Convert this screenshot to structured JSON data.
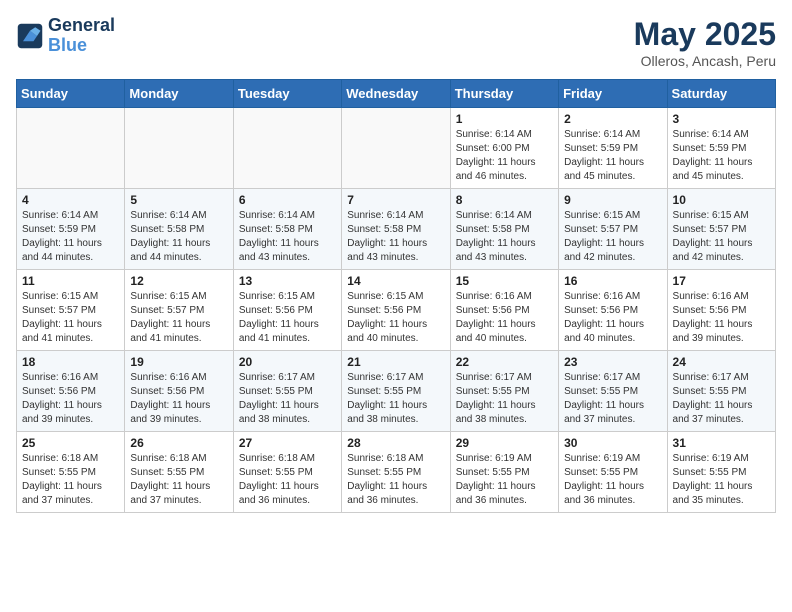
{
  "logo": {
    "line1": "General",
    "line2": "Blue"
  },
  "title": "May 2025",
  "subtitle": "Olleros, Ancash, Peru",
  "weekdays": [
    "Sunday",
    "Monday",
    "Tuesday",
    "Wednesday",
    "Thursday",
    "Friday",
    "Saturday"
  ],
  "weeks": [
    [
      {
        "day": "",
        "sunrise": "",
        "sunset": "",
        "daylight": ""
      },
      {
        "day": "",
        "sunrise": "",
        "sunset": "",
        "daylight": ""
      },
      {
        "day": "",
        "sunrise": "",
        "sunset": "",
        "daylight": ""
      },
      {
        "day": "",
        "sunrise": "",
        "sunset": "",
        "daylight": ""
      },
      {
        "day": "1",
        "sunrise": "Sunrise: 6:14 AM",
        "sunset": "Sunset: 6:00 PM",
        "daylight": "Daylight: 11 hours and 46 minutes."
      },
      {
        "day": "2",
        "sunrise": "Sunrise: 6:14 AM",
        "sunset": "Sunset: 5:59 PM",
        "daylight": "Daylight: 11 hours and 45 minutes."
      },
      {
        "day": "3",
        "sunrise": "Sunrise: 6:14 AM",
        "sunset": "Sunset: 5:59 PM",
        "daylight": "Daylight: 11 hours and 45 minutes."
      }
    ],
    [
      {
        "day": "4",
        "sunrise": "Sunrise: 6:14 AM",
        "sunset": "Sunset: 5:59 PM",
        "daylight": "Daylight: 11 hours and 44 minutes."
      },
      {
        "day": "5",
        "sunrise": "Sunrise: 6:14 AM",
        "sunset": "Sunset: 5:58 PM",
        "daylight": "Daylight: 11 hours and 44 minutes."
      },
      {
        "day": "6",
        "sunrise": "Sunrise: 6:14 AM",
        "sunset": "Sunset: 5:58 PM",
        "daylight": "Daylight: 11 hours and 43 minutes."
      },
      {
        "day": "7",
        "sunrise": "Sunrise: 6:14 AM",
        "sunset": "Sunset: 5:58 PM",
        "daylight": "Daylight: 11 hours and 43 minutes."
      },
      {
        "day": "8",
        "sunrise": "Sunrise: 6:14 AM",
        "sunset": "Sunset: 5:58 PM",
        "daylight": "Daylight: 11 hours and 43 minutes."
      },
      {
        "day": "9",
        "sunrise": "Sunrise: 6:15 AM",
        "sunset": "Sunset: 5:57 PM",
        "daylight": "Daylight: 11 hours and 42 minutes."
      },
      {
        "day": "10",
        "sunrise": "Sunrise: 6:15 AM",
        "sunset": "Sunset: 5:57 PM",
        "daylight": "Daylight: 11 hours and 42 minutes."
      }
    ],
    [
      {
        "day": "11",
        "sunrise": "Sunrise: 6:15 AM",
        "sunset": "Sunset: 5:57 PM",
        "daylight": "Daylight: 11 hours and 41 minutes."
      },
      {
        "day": "12",
        "sunrise": "Sunrise: 6:15 AM",
        "sunset": "Sunset: 5:57 PM",
        "daylight": "Daylight: 11 hours and 41 minutes."
      },
      {
        "day": "13",
        "sunrise": "Sunrise: 6:15 AM",
        "sunset": "Sunset: 5:56 PM",
        "daylight": "Daylight: 11 hours and 41 minutes."
      },
      {
        "day": "14",
        "sunrise": "Sunrise: 6:15 AM",
        "sunset": "Sunset: 5:56 PM",
        "daylight": "Daylight: 11 hours and 40 minutes."
      },
      {
        "day": "15",
        "sunrise": "Sunrise: 6:16 AM",
        "sunset": "Sunset: 5:56 PM",
        "daylight": "Daylight: 11 hours and 40 minutes."
      },
      {
        "day": "16",
        "sunrise": "Sunrise: 6:16 AM",
        "sunset": "Sunset: 5:56 PM",
        "daylight": "Daylight: 11 hours and 40 minutes."
      },
      {
        "day": "17",
        "sunrise": "Sunrise: 6:16 AM",
        "sunset": "Sunset: 5:56 PM",
        "daylight": "Daylight: 11 hours and 39 minutes."
      }
    ],
    [
      {
        "day": "18",
        "sunrise": "Sunrise: 6:16 AM",
        "sunset": "Sunset: 5:56 PM",
        "daylight": "Daylight: 11 hours and 39 minutes."
      },
      {
        "day": "19",
        "sunrise": "Sunrise: 6:16 AM",
        "sunset": "Sunset: 5:56 PM",
        "daylight": "Daylight: 11 hours and 39 minutes."
      },
      {
        "day": "20",
        "sunrise": "Sunrise: 6:17 AM",
        "sunset": "Sunset: 5:55 PM",
        "daylight": "Daylight: 11 hours and 38 minutes."
      },
      {
        "day": "21",
        "sunrise": "Sunrise: 6:17 AM",
        "sunset": "Sunset: 5:55 PM",
        "daylight": "Daylight: 11 hours and 38 minutes."
      },
      {
        "day": "22",
        "sunrise": "Sunrise: 6:17 AM",
        "sunset": "Sunset: 5:55 PM",
        "daylight": "Daylight: 11 hours and 38 minutes."
      },
      {
        "day": "23",
        "sunrise": "Sunrise: 6:17 AM",
        "sunset": "Sunset: 5:55 PM",
        "daylight": "Daylight: 11 hours and 37 minutes."
      },
      {
        "day": "24",
        "sunrise": "Sunrise: 6:17 AM",
        "sunset": "Sunset: 5:55 PM",
        "daylight": "Daylight: 11 hours and 37 minutes."
      }
    ],
    [
      {
        "day": "25",
        "sunrise": "Sunrise: 6:18 AM",
        "sunset": "Sunset: 5:55 PM",
        "daylight": "Daylight: 11 hours and 37 minutes."
      },
      {
        "day": "26",
        "sunrise": "Sunrise: 6:18 AM",
        "sunset": "Sunset: 5:55 PM",
        "daylight": "Daylight: 11 hours and 37 minutes."
      },
      {
        "day": "27",
        "sunrise": "Sunrise: 6:18 AM",
        "sunset": "Sunset: 5:55 PM",
        "daylight": "Daylight: 11 hours and 36 minutes."
      },
      {
        "day": "28",
        "sunrise": "Sunrise: 6:18 AM",
        "sunset": "Sunset: 5:55 PM",
        "daylight": "Daylight: 11 hours and 36 minutes."
      },
      {
        "day": "29",
        "sunrise": "Sunrise: 6:19 AM",
        "sunset": "Sunset: 5:55 PM",
        "daylight": "Daylight: 11 hours and 36 minutes."
      },
      {
        "day": "30",
        "sunrise": "Sunrise: 6:19 AM",
        "sunset": "Sunset: 5:55 PM",
        "daylight": "Daylight: 11 hours and 36 minutes."
      },
      {
        "day": "31",
        "sunrise": "Sunrise: 6:19 AM",
        "sunset": "Sunset: 5:55 PM",
        "daylight": "Daylight: 11 hours and 35 minutes."
      }
    ]
  ]
}
